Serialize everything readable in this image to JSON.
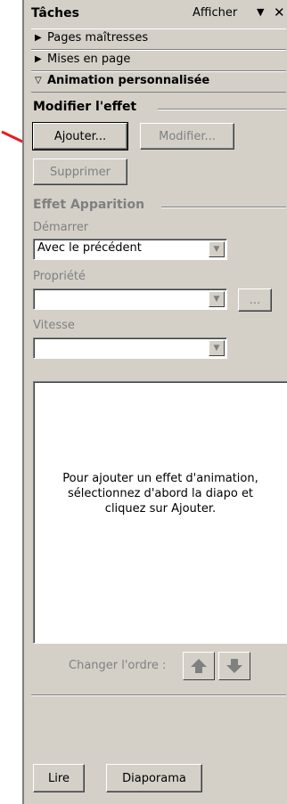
{
  "header": {
    "title": "Tâches",
    "view_label": "Afficher",
    "dropdown_glyph": "▼",
    "close_glyph": "✕"
  },
  "sections": [
    {
      "label": "Pages maîtresses",
      "icon": "triangle-right-icon"
    },
    {
      "label": "Mises en page",
      "icon": "triangle-right-icon"
    },
    {
      "label": "Animation personnalisée",
      "icon": "triangle-down-icon"
    }
  ],
  "modify_effect": {
    "group_title": "Modifier l'effet",
    "add_button": "Ajouter...",
    "modify_button": "Modifier...",
    "delete_button": "Supprimer"
  },
  "effect": {
    "group_title": "Effet Apparition",
    "start_label": "Démarrer",
    "start_value": "Avec le précédent",
    "property_label": "Propriété",
    "property_value": "",
    "property_more_button": "...",
    "speed_label": "Vitesse",
    "speed_value": ""
  },
  "list": {
    "empty_message": "Pour ajouter un effet d'animation, sélectionnez d'abord la diapo et cliquez sur Ajouter."
  },
  "order": {
    "label": "Changer l'ordre :",
    "up_icon": "arrow-up-icon",
    "down_icon": "arrow-down-icon"
  },
  "footer": {
    "play_button": "Lire",
    "slideshow_button": "Diaporama"
  },
  "colors": {
    "panel_bg": "#d4d0c8",
    "annotation_arrow": "#e02020",
    "disabled_text": "#808080"
  }
}
